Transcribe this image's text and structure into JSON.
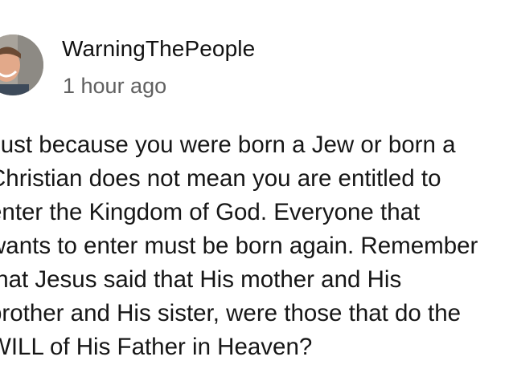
{
  "comment": {
    "author": "WarningThePeople",
    "timestamp": "1 hour ago",
    "avatar_icon": "user-avatar-photo",
    "lines": [
      "Just because you were born a Jew or born a",
      "Christian does not mean you are entitled to",
      "enter the Kingdom of God. Everyone that",
      "wants to enter must be born again. Remember",
      "that Jesus said that His mother and His",
      "brother and His sister, were those that do the",
      "WILL of His Father in Heaven?"
    ]
  }
}
